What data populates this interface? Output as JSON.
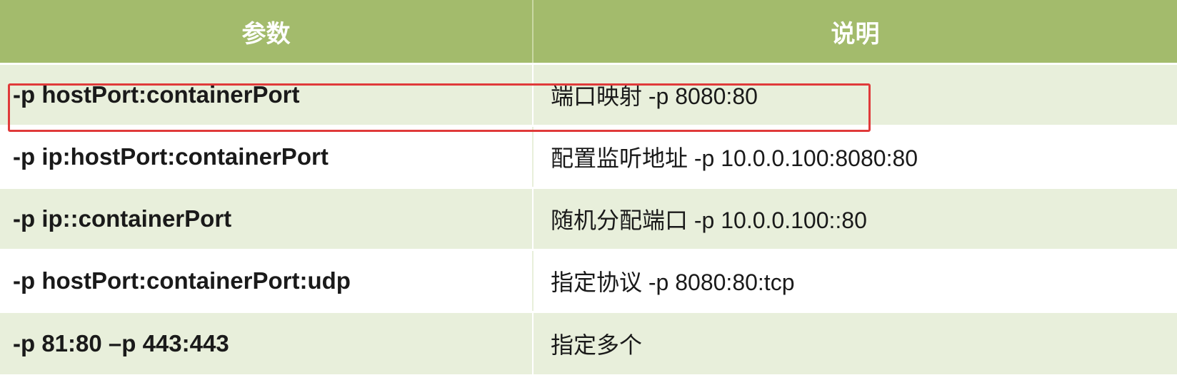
{
  "table": {
    "headers": [
      "参数",
      "说明"
    ],
    "rows": [
      {
        "param": "-p hostPort:containerPort",
        "desc": "端口映射  -p 8080:80"
      },
      {
        "param": "-p ip:hostPort:containerPort",
        "desc": "配置监听地址 -p 10.0.0.100:8080:80"
      },
      {
        "param": "-p ip::containerPort",
        "desc": "随机分配端口 -p 10.0.0.100::80"
      },
      {
        "param": "-p hostPort:containerPort:udp",
        "desc": "指定协议 -p 8080:80:tcp"
      },
      {
        "param": "-p 81:80 –p 443:443",
        "desc": "指定多个"
      }
    ]
  },
  "colors": {
    "header_bg": "#a3bb6c",
    "row_alt_bg": "#e8efdb",
    "highlight": "#e03a3a"
  }
}
